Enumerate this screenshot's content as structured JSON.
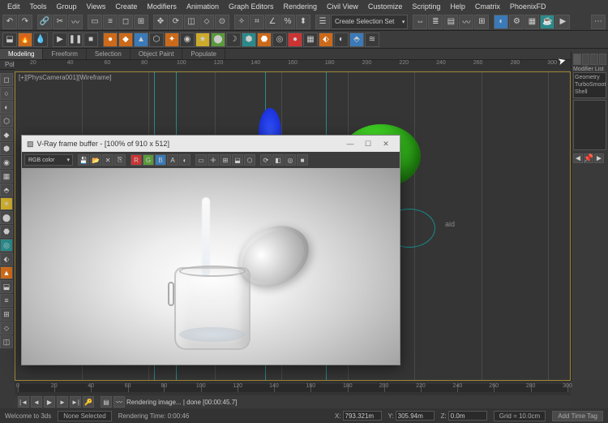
{
  "menu": [
    "Edit",
    "Tools",
    "Group",
    "Views",
    "Create",
    "Modifiers",
    "Animation",
    "Graph Editors",
    "Rendering",
    "Civil View",
    "Customize",
    "Scripting",
    "Help",
    "Cmatrix",
    "PhoenixFD"
  ],
  "toolbar1_dropdown": "Create Selection Set",
  "ribbon": {
    "tabs": [
      "Modeling",
      "Freeform",
      "Selection",
      "Object Paint",
      "Populate"
    ],
    "active": 0,
    "sub": "Polygon Modeling"
  },
  "viewport": {
    "label": "[+][PhysCamera001][Wireframe]",
    "aid_text": "aid"
  },
  "ruler_ticks": [
    "20",
    "40",
    "60",
    "80",
    "100",
    "120",
    "140",
    "160",
    "180",
    "200",
    "220",
    "240",
    "260",
    "280",
    "300"
  ],
  "render_window": {
    "title": "V-Ray frame buffer - [100% of 910 x 512]",
    "channel": "RGB color"
  },
  "command_panel": {
    "modifier_label": "Modifier List",
    "stack": [
      "Geometry",
      "TurboSmooth",
      "Shell"
    ]
  },
  "timeline_ticks": [
    "0",
    "20",
    "40",
    "60",
    "80",
    "100",
    "120",
    "140",
    "160",
    "180",
    "200",
    "220",
    "240",
    "260",
    "280",
    "300"
  ],
  "playback": {
    "status": "Rendering image... | done [00:00:45.7]"
  },
  "status": {
    "welcome": "Welcome to 3ds",
    "selection": "None Selected",
    "render_time": "Rendering Time: 0:00:46",
    "x": "793.321m",
    "y": "305.94m",
    "z": "0.0m",
    "grid": "Grid = 10.0cm",
    "add_tag": "Add Time Tag"
  }
}
